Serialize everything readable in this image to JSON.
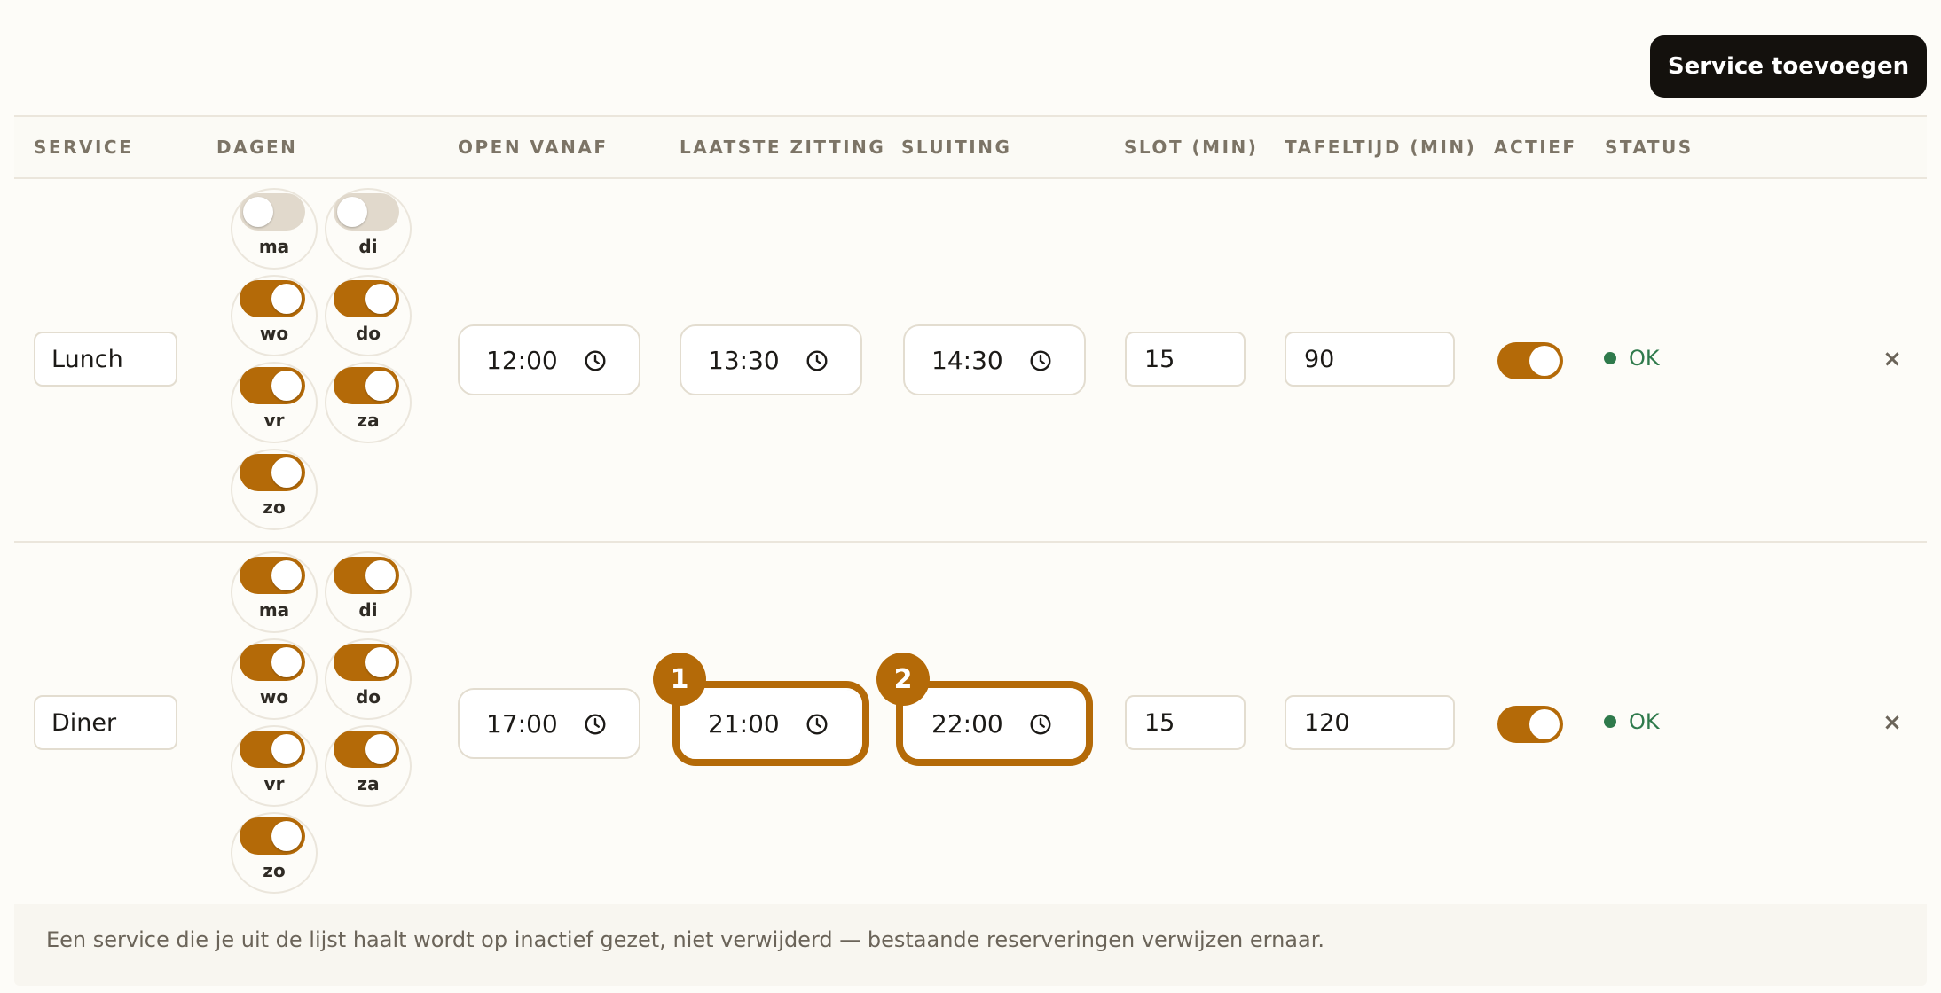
{
  "toolbar": {
    "add_label": "Service toevoegen"
  },
  "columns": [
    "SERVICE",
    "DAGEN",
    "OPEN VANAF",
    "LAATSTE ZITTING",
    "SLUITING",
    "SLOT (MIN)",
    "TAFELTIJD (MIN)",
    "ACTIEF",
    "STATUS"
  ],
  "rows": [
    {
      "name": "Lunch",
      "days": [
        {
          "label": "ma",
          "on": false
        },
        {
          "label": "di",
          "on": false
        },
        {
          "label": "wo",
          "on": true
        },
        {
          "label": "do",
          "on": true
        },
        {
          "label": "vr",
          "on": true
        },
        {
          "label": "za",
          "on": true
        },
        {
          "label": "zo",
          "on": true
        }
      ],
      "open_from": "12:00",
      "last_seating": "13:30",
      "closing": "14:30",
      "slot_min": "15",
      "table_time_min": "90",
      "active": true,
      "status": "OK",
      "remove": "×"
    },
    {
      "name": "Diner",
      "days": [
        {
          "label": "ma",
          "on": true
        },
        {
          "label": "di",
          "on": true
        },
        {
          "label": "wo",
          "on": true
        },
        {
          "label": "do",
          "on": true
        },
        {
          "label": "vr",
          "on": true
        },
        {
          "label": "za",
          "on": true
        },
        {
          "label": "zo",
          "on": true
        }
      ],
      "open_from": "17:00",
      "last_seating": "21:00",
      "closing": "22:00",
      "slot_min": "15",
      "table_time_min": "120",
      "active": true,
      "status": "OK",
      "remove": "×"
    }
  ],
  "callouts": [
    "1",
    "2"
  ],
  "footer_note": "Een service die je uit de lijst haalt wordt op inactief gezet, niet verwijderd — bestaande reserveringen verwijzen ernaar.",
  "colors": {
    "accent": "#b46a08",
    "status_ok": "#2f7a4c",
    "button_dark": "#14110d"
  },
  "icons": {
    "time_field": "clock-icon",
    "remove": "close-icon"
  }
}
